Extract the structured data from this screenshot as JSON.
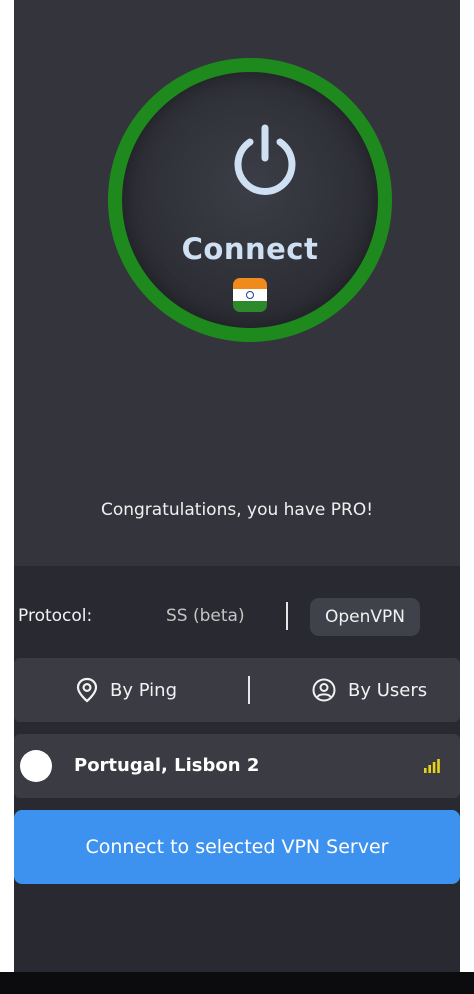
{
  "power": {
    "label": "Connect",
    "status_color": "#1e8a1e",
    "country_flag": "india-flag-icon"
  },
  "pro_message": "Congratulations, you have PRO!",
  "protocol": {
    "label": "Protocol:",
    "options": [
      "SS (beta)",
      "OpenVPN"
    ],
    "selected": "OpenVPN"
  },
  "sort": {
    "by_ping": "By Ping",
    "by_users": "By Users"
  },
  "server": {
    "name": "Portugal, Lisbon 2",
    "signal_icon": "signal-bars-icon",
    "signal_color": "#e9d21a"
  },
  "connect_button": "Connect to selected VPN Server",
  "accent_color": "#3e92ef"
}
